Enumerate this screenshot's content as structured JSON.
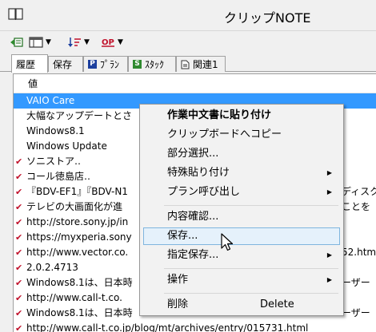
{
  "window": {
    "title": "クリップNOTE"
  },
  "tabs": [
    {
      "label": "履歴",
      "active": true
    },
    {
      "label": "保存",
      "active": false
    },
    {
      "label": "ﾌﾟﾗﾝ",
      "badge": "P",
      "badge_color": "#1c3f9e"
    },
    {
      "label": "ｽﾀｯｸ",
      "badge": "S",
      "badge_color": "#2f8a2f"
    },
    {
      "label": "関連1",
      "badge": "doc"
    }
  ],
  "list": {
    "column_header": "値",
    "rows": [
      {
        "text": "VAIO Care",
        "checked": false,
        "selected": true
      },
      {
        "text": "大幅なアップデートとさ",
        "checked": false
      },
      {
        "text": "Windows8.1",
        "checked": false
      },
      {
        "text": "Windows Update",
        "checked": false
      },
      {
        "text": "ソニストア‥",
        "checked": true
      },
      {
        "text": "コール徳島店‥",
        "checked": true
      },
      {
        "text": "『BDV-EF1』『BDV-N1",
        "checked": true
      },
      {
        "text": "テレビの大画面化が進",
        "checked": true
      },
      {
        "text": "http://store.sony.jp/in",
        "checked": true
      },
      {
        "text": "https://myxperia.sony",
        "checked": true
      },
      {
        "text": "http://www.vector.co.",
        "checked": true
      },
      {
        "text": "2.0.2.4713",
        "checked": true
      },
      {
        "text": "Windows8.1は、日本時",
        "checked": true
      },
      {
        "text": "http://www.call-t.co.",
        "checked": true
      },
      {
        "text": "Windows8.1は、日本時",
        "checked": true
      },
      {
        "text": "http://www.call-t.co.jp/blog/mt/archives/entry/015731.html",
        "checked": true
      }
    ],
    "overflow_right": [
      {
        "row": 6,
        "text": "ディスク"
      },
      {
        "row": 7,
        "text": "ことを"
      },
      {
        "row": 10,
        "text": "52.htm"
      },
      {
        "row": 12,
        "text": "ーザー"
      },
      {
        "row": 14,
        "text": "ーザー"
      }
    ]
  },
  "context_menu": {
    "items": [
      {
        "label": "作業中文書に貼り付け",
        "bold": true
      },
      {
        "label": "クリップボードへコピー"
      },
      {
        "label": "部分選択..."
      },
      {
        "label": "特殊貼り付け",
        "submenu": true
      },
      {
        "label": "プラン呼び出し",
        "submenu": true
      },
      {
        "label": "内容確認..."
      },
      {
        "label": "保存...",
        "hover": true
      },
      {
        "label": "指定保存...",
        "submenu": true
      },
      {
        "label": "操作",
        "submenu": true
      },
      {
        "label": "削除",
        "shortcut": "Delete"
      }
    ]
  },
  "icons": {
    "app": "notebook-icon",
    "toolbar": [
      "export-icon",
      "columns-icon",
      "sort-icon",
      "op-icon"
    ],
    "check": "check-mark-icon",
    "cursor": "mouse-pointer-icon"
  },
  "colors": {
    "selection": "#3399ff",
    "check_mark": "#c0102a",
    "menu_hover": "#e5f1fb"
  }
}
